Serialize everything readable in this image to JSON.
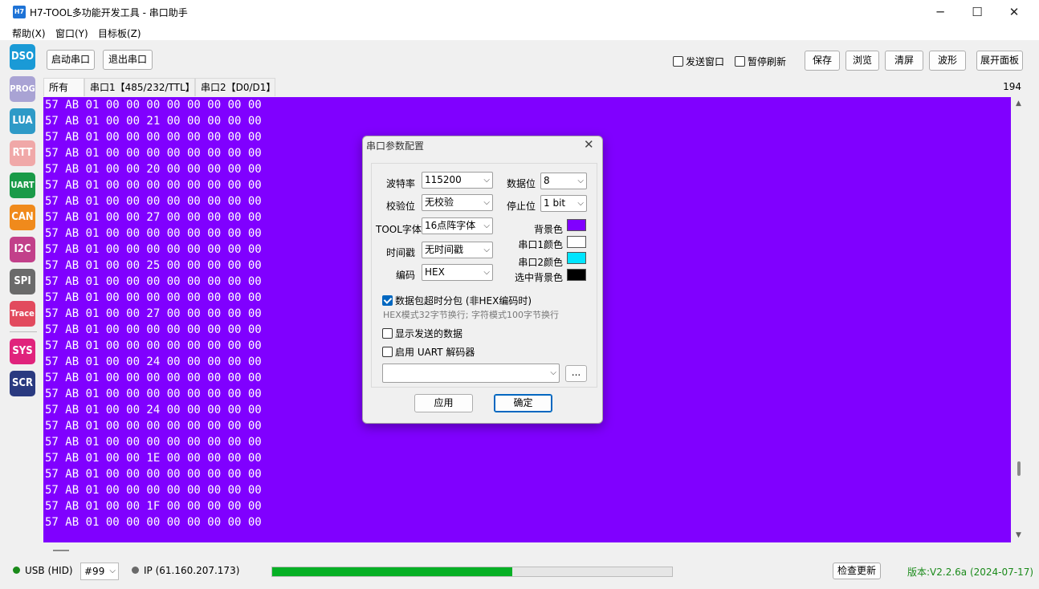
{
  "window": {
    "icon_text": "H7",
    "title": "H7-TOOL多功能开发工具 - 串口助手",
    "min_symbol": "─",
    "max_symbol": "☐",
    "close_symbol": "✕"
  },
  "menu": [
    "帮助(X)",
    "窗口(Y)",
    "目标板(Z)"
  ],
  "sidebar": [
    {
      "label": "DSO",
      "color": "#1a9ad6"
    },
    {
      "label": "PROG",
      "color": "#a9a3d4"
    },
    {
      "label": "LUA",
      "color": "#2e9ac7"
    },
    {
      "label": "RTT",
      "color": "#f0a8a8"
    },
    {
      "label": "UART",
      "color": "#1a9a48"
    },
    {
      "label": "CAN",
      "color": "#f08a1c"
    },
    {
      "label": "I2C",
      "color": "#c2408a"
    },
    {
      "label": "SPI",
      "color": "#6a6a6a"
    },
    {
      "label": "Trace",
      "color": "#e24a5e"
    },
    {
      "label": "SYS",
      "color": "#e0237c"
    },
    {
      "label": "SCR",
      "color": "#2a3a80"
    }
  ],
  "toolbar": {
    "start_label": "启动串口",
    "exit_label": "退出串口",
    "send_window_label": "发送窗口",
    "pause_refresh_label": "暂停刷新",
    "save_label": "保存",
    "browse_label": "浏览",
    "clear_label": "清屏",
    "wave_label": "波形",
    "panel_label": "展开面板"
  },
  "tabs": [
    "所有",
    "串口1【485/232/TTL】",
    "串口2【D0/D1】"
  ],
  "counter": "194",
  "colors": {
    "data_bg": "#8000ff",
    "uart1": "#ffffff",
    "uart2": "#00e5ff",
    "selected_bg": "#000000",
    "progress": "#06b025",
    "version_text": "#1a8a1a"
  },
  "hex_lines": [
    "57 AB 01 00 00 00 00 00 00 00 00",
    "57 AB 01 00 00 21 00 00 00 00 00",
    "57 AB 01 00 00 00 00 00 00 00 00",
    "57 AB 01 00 00 00 00 00 00 00 00",
    "57 AB 01 00 00 20 00 00 00 00 00",
    "57 AB 01 00 00 00 00 00 00 00 00",
    "57 AB 01 00 00 00 00 00 00 00 00",
    "57 AB 01 00 00 27 00 00 00 00 00",
    "57 AB 01 00 00 00 00 00 00 00 00",
    "57 AB 01 00 00 00 00 00 00 00 00",
    "57 AB 01 00 00 25 00 00 00 00 00",
    "57 AB 01 00 00 00 00 00 00 00 00",
    "57 AB 01 00 00 00 00 00 00 00 00",
    "57 AB 01 00 00 27 00 00 00 00 00",
    "57 AB 01 00 00 00 00 00 00 00 00",
    "57 AB 01 00 00 00 00 00 00 00 00",
    "57 AB 01 00 00 24 00 00 00 00 00",
    "57 AB 01 00 00 00 00 00 00 00 00",
    "57 AB 01 00 00 00 00 00 00 00 00",
    "57 AB 01 00 00 24 00 00 00 00 00",
    "57 AB 01 00 00 00 00 00 00 00 00",
    "57 AB 01 00 00 00 00 00 00 00 00",
    "57 AB 01 00 00 1E 00 00 00 00 00",
    "57 AB 01 00 00 00 00 00 00 00 00",
    "57 AB 01 00 00 00 00 00 00 00 00",
    "57 AB 01 00 00 1F 00 00 00 00 00",
    "57 AB 01 00 00 00 00 00 00 00 00"
  ],
  "status": {
    "usb_label": "USB (HID)",
    "usb_color": "#1a8a1a",
    "device_value": "#99",
    "ip_label": "IP (61.160.207.173)",
    "ip_color": "#6a6a6a",
    "progress_fraction": 0.6,
    "check_update_label": "检查更新",
    "version": "版本:V2.2.6a (2024-07-17)"
  },
  "dialog": {
    "title": "串口参数配置",
    "baud_label": "波特率",
    "baud_value": "115200",
    "databits_label": "数据位",
    "databits_value": "8",
    "parity_label": "校验位",
    "parity_value": "无校验",
    "stopbits_label": "停止位",
    "stopbits_value": "1 bit",
    "font_label": "TOOL字体",
    "font_value": "16点阵字体",
    "bgcolor_label": "背景色",
    "uart1_color_label": "串口1颜色",
    "uart2_color_label": "串口2颜色",
    "timestamp_label": "时间戳",
    "timestamp_value": "无时间戳",
    "select_bg_label": "选中背景色",
    "encoding_label": "编码",
    "encoding_value": "HEX",
    "packet_split_label": "数据包超时分包 (非HEX编码时)",
    "packet_split_checked": true,
    "hint": "HEX模式32字节换行; 字符模式100字节换行",
    "show_sent_label": "显示发送的数据",
    "uart_decoder_label": "启用 UART 解码器",
    "decoder_value": "",
    "browse_label": "...",
    "apply_label": "应用",
    "ok_label": "确定"
  }
}
